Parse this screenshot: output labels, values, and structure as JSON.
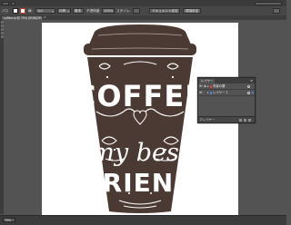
{
  "options_bar": {
    "mode_label": "パス",
    "stroke_weight_label": "線:",
    "stroke_weight_value": "1pt",
    "profile_label": "均等",
    "brush_label": "基本",
    "opacity_label": "不透明度:",
    "opacity_value": "100%",
    "style_label": "スタイル:",
    "doc_setup_button": "ドキュメント設定",
    "prefs_button": "環境設定"
  },
  "document_tab": {
    "title": "coffee.ai @ 75% (RGB/GPU プレビュー)",
    "close_glyph": "×"
  },
  "artwork": {
    "line1": "COFFEE",
    "line2": "my best",
    "line3": "FRIEND"
  },
  "status_bar": {
    "zoom": "75%"
  },
  "layers_panel": {
    "tab_label": "レイヤー",
    "menu_glyph": "≡",
    "layers": [
      {
        "name": "背景の層",
        "color": "#e04040"
      },
      {
        "name": "レイヤー 1",
        "color": "#4a7fd8"
      }
    ],
    "footer_count": "2 レイヤー"
  },
  "colors": {
    "ui_bg": "#535353",
    "panel_bg": "#535353",
    "artwork": "#4b3a33",
    "stroke_accent": "#c43a2c"
  },
  "icons": {
    "eye": "eye-icon",
    "lock": "lock-icon",
    "target": "target-icon",
    "new_layer": "new-layer-icon",
    "delete": "trash-icon"
  }
}
